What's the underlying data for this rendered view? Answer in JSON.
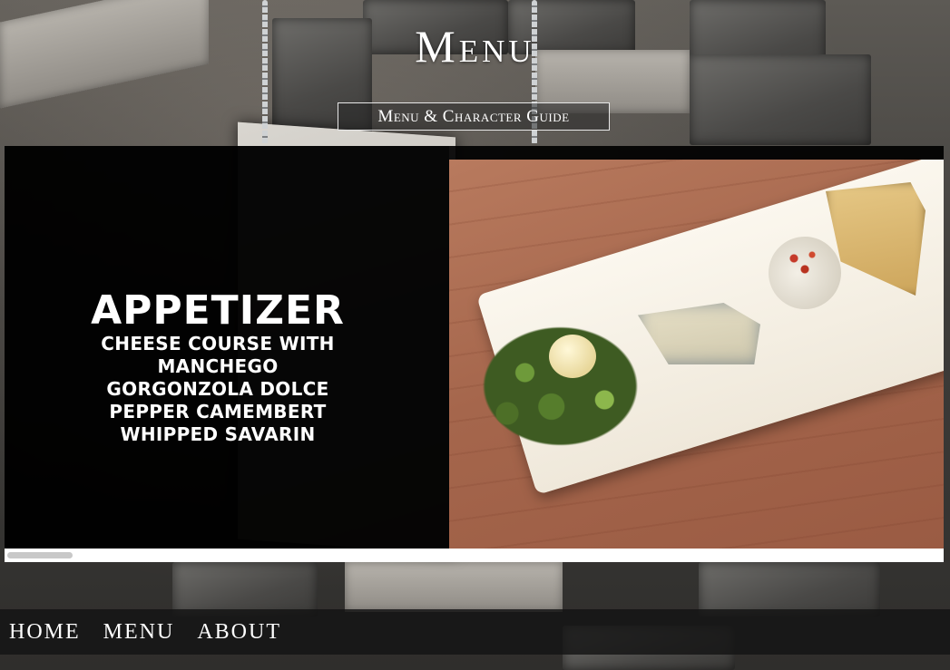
{
  "header": {
    "title": "Menu",
    "guide_button_label": "Menu & Character Guide"
  },
  "carousel": {
    "slide": {
      "heading": "APPETIZER",
      "lines": [
        "CHEESE COURSE WITH",
        "MANCHEGO",
        "GORGONZOLA DOLCE",
        "PEPPER CAMEMBERT",
        "WHIPPED SAVARIN"
      ],
      "image_name": "cheese-plate-photo"
    },
    "scroll_position": 0.0
  },
  "nav": {
    "items": [
      "HOME",
      "MENU",
      "ABOUT"
    ]
  },
  "colors": {
    "nav_background": "#141414",
    "text": "#ffffff"
  }
}
